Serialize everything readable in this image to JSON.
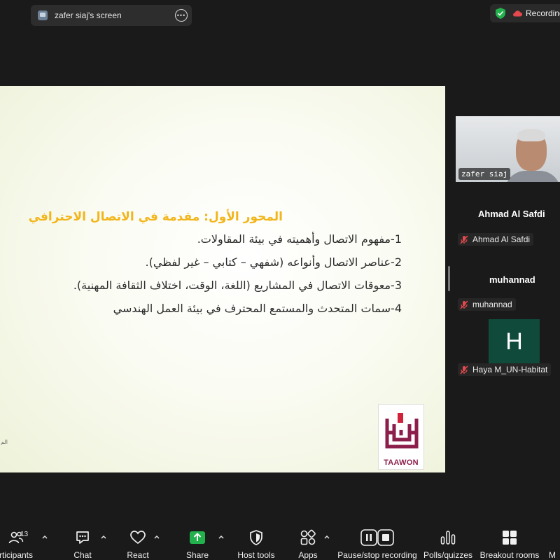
{
  "top_bar": {
    "share_tab_label": "zafer siaj's screen",
    "recording_label": "Recording"
  },
  "slide": {
    "heading": "المحور الأول: مقدمة في الاتصال الاحترافي",
    "lines": [
      "1-مفهوم الاتصال وأهميته في بيئة المقاولات.",
      "2-عناصر الاتصال وأنواعه (شفهي – كتابي – غير لفظي).",
      "3-معوقات الاتصال في المشاريع (اللغة، الوقت، اختلاف الثقافة المهنية).",
      "4-سمات المتحدث والمستمع المحترف في بيئة العمل الهندسي"
    ],
    "footnote": "الم",
    "logo_text": "TAAWON"
  },
  "gallery": {
    "video_name": "zafer siaj",
    "participants": [
      {
        "name": "Ahmad Al Safdi",
        "tag": "Ahmad Al Safdi"
      },
      {
        "name": "muhannad",
        "tag": "muhannad"
      },
      {
        "initial": "H",
        "tag": "Haya M_UN-Habitat"
      }
    ]
  },
  "toolbar": {
    "participants_count": "13",
    "items": [
      {
        "label": "rticipants",
        "icon": "participants-icon"
      },
      {
        "label": "Chat",
        "icon": "chat-icon"
      },
      {
        "label": "React",
        "icon": "heart-icon"
      },
      {
        "label": "Share",
        "icon": "share-icon"
      },
      {
        "label": "Host tools",
        "icon": "shield-icon"
      },
      {
        "label": "Apps",
        "icon": "apps-icon"
      },
      {
        "label": "Pause/stop recording",
        "icon": "pause-stop-icon"
      },
      {
        "label": "Polls/quizzes",
        "icon": "polls-icon"
      },
      {
        "label": "Breakout rooms",
        "icon": "breakout-icon"
      },
      {
        "label": "M",
        "icon": "more-icon"
      }
    ]
  },
  "colors": {
    "heading": "#f2b51a",
    "accent_green": "#22b14c",
    "mic_off_red": "#e5484d",
    "avatar_bg": "#0f4a3a"
  }
}
